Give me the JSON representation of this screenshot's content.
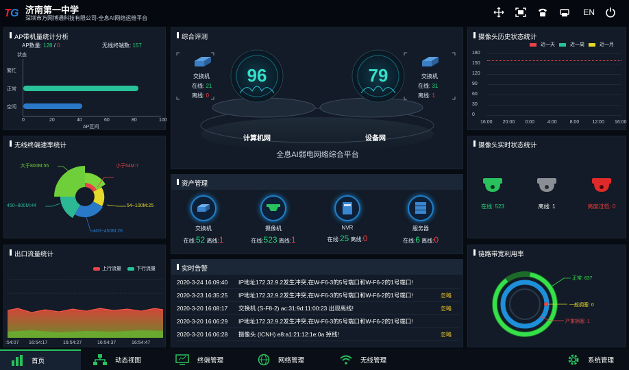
{
  "header": {
    "title": "济南第一中学",
    "subtitle": "深圳市万网博通科技有限公司-全息AI网络运维平台",
    "lang": "EN"
  },
  "ap_panel": {
    "title": "AP带机量统计分析",
    "ap_label": "AP数量:",
    "ap_online": "128",
    "ap_sep": "/",
    "ap_offline": "0",
    "terminal_label": "无线终端数:",
    "terminal_count": "157",
    "y_axis_label": "状态",
    "x_axis_label": "AP区间",
    "categories": [
      "繁忙",
      "正常",
      "空闲"
    ],
    "values": [
      0,
      84,
      43
    ],
    "xticks": [
      "0",
      "20",
      "40",
      "60",
      "80",
      "100"
    ],
    "xmax": 100
  },
  "rate_panel": {
    "title": "无线终端速率统计",
    "labels": {
      "l1": "小于54M:7",
      "l2": "54~100M:25",
      "l3": "100~450M:26",
      "l4": "450~800M:44",
      "l5": "大于800M:55"
    }
  },
  "traffic_panel": {
    "title": "出口流量统计",
    "legend_up": "上行流量",
    "legend_down": "下行流量",
    "xticks": [
      ":54:07",
      "16:54:17",
      "16:54:27",
      "16:54:37",
      "16:54:47"
    ]
  },
  "overview": {
    "title": "综合评测",
    "left_device": "交换机",
    "left_online_label": "在线:",
    "left_online": "21",
    "left_offline_label": "离线:",
    "left_offline": "0",
    "right_device": "交换机",
    "right_online_label": "在线:",
    "right_online": "31",
    "right_offline_label": "离线:",
    "right_offline": "1",
    "score_left": "96",
    "score_right": "79",
    "label_left": "计算机网",
    "label_right": "设备网",
    "platform": "全息AI弱电网络综合平台"
  },
  "assets": {
    "title": "资产管理",
    "items": [
      {
        "name": "交换机",
        "online_label": "在线:",
        "online": "52",
        "offline_label": "离线:",
        "offline": "1"
      },
      {
        "name": "摄像机",
        "online_label": "在线:",
        "online": "523",
        "offline_label": "离线:",
        "offline": "1"
      },
      {
        "name": "NVR",
        "online_label": "在线:",
        "online": "25",
        "offline_label": "离线:",
        "offline": "0"
      },
      {
        "name": "服务器",
        "online_label": "在线:",
        "online": "6",
        "offline_label": "离线:",
        "offline": "0"
      }
    ]
  },
  "alarms": {
    "title": "实时告警",
    "rows": [
      {
        "time": "2020-3-24 16:09:40",
        "desc": "IP地址172.32.9.2发生冲突,在W-F6-3的5号端口和W-F6-2的1号端口!",
        "action": ""
      },
      {
        "time": "2020-3-23 16:35:25",
        "desc": "IP地址172.32.9.2发生冲突,在W-F6-3的5号端口和W-F6-2的1号端口!",
        "action": "忽略"
      },
      {
        "time": "2020-3-20 16:08:17",
        "desc": "交换机 (S-F8-2) ac:31:9d:11:00:23 出现离线!",
        "action": "忽略"
      },
      {
        "time": "2020-3-20 16:06:29",
        "desc": "IP地址172.32.9.2发生冲突,在W-F6-3的5号端口和W-F6-2的1号端口!",
        "action": ""
      },
      {
        "time": "2020-3-20 16:06:28",
        "desc": "摄像头 (ICNH) e8:a1:21:12:1e:0a 掉线!",
        "action": "忽略"
      }
    ]
  },
  "cam_history": {
    "title": "摄像头历史状态统计",
    "legend": [
      "近一天",
      "近一周",
      "近一月"
    ],
    "yticks": [
      "180",
      "150",
      "120",
      "90",
      "60",
      "30",
      "0"
    ],
    "xticks": [
      "16:00",
      "20:00",
      "0:00",
      "4:00",
      "8:00",
      "12:00",
      "16:00"
    ],
    "value": 160,
    "ymax": 180
  },
  "cam_realtime": {
    "title": "摄像头实时状态统计",
    "items": [
      {
        "label": "在线: 523"
      },
      {
        "label": "离线: 1"
      },
      {
        "label": "亮度过低: 0"
      }
    ]
  },
  "link": {
    "title": "链路带宽利用率",
    "normal": "正常: 637",
    "busy": "一般拥塞: 0",
    "severe": "严重拥塞: 1"
  },
  "nav": {
    "items": [
      "首页",
      "动态视图",
      "终端管理",
      "网络管理",
      "无线管理",
      "系统管理"
    ]
  },
  "colors": {
    "green": "#28d67a",
    "red": "#ff3b3b",
    "yellow": "#e5d82b",
    "blue": "#2a79c9",
    "teal": "#29c39a"
  }
}
